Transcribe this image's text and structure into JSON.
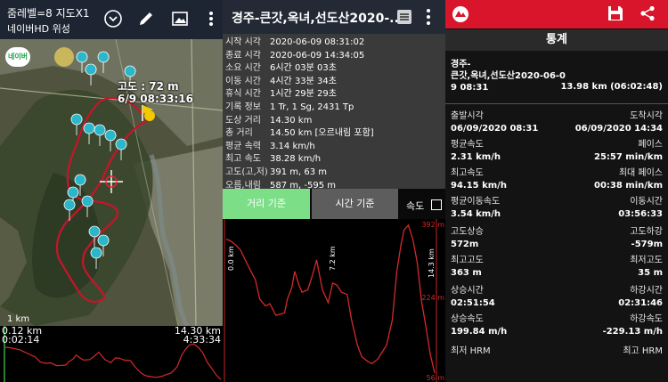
{
  "map_panel": {
    "status_line1": "줌레벨=8 지도X1",
    "status_line2": "네이버HD 위성",
    "naver_badge": "네이버",
    "altitude_line1": "고도 : 72 m",
    "altitude_line2": "6/9 08:33:16",
    "scale": "1 km",
    "chart_left_top": "0.12 km",
    "chart_left_bottom": "0:02:14",
    "chart_right_top": "14.30 km",
    "chart_right_bottom": "4:33:34",
    "icons": [
      "chevron-down-icon",
      "pencil-icon",
      "image-icon",
      "more-vert-icon"
    ]
  },
  "track_panel": {
    "title": "경주-큰갓,옥녀,선도산2020-...",
    "stats": [
      {
        "key": "시작 시각",
        "value": "2020-06-09 08:31:02"
      },
      {
        "key": "종료 시각",
        "value": "2020-06-09 14:34:05"
      },
      {
        "key": "소요 시간",
        "value": "6시간 03분 03초"
      },
      {
        "key": "이동 시간",
        "value": "4시간 33분 34초"
      },
      {
        "key": "휴식 시간",
        "value": "1시간 29분 29초"
      },
      {
        "key": "기록 정보",
        "value": "1 Tr, 1 Sg, 2431 Tp"
      },
      {
        "key": "도상 거리",
        "value": "14.30 km"
      },
      {
        "key": "총 거리",
        "value": "14.50 km [오르내림 포함]"
      },
      {
        "key": "평균 속력",
        "value": "3.14 km/h"
      },
      {
        "key": "최고 속도",
        "value": "38.28 km/h"
      },
      {
        "key": "고도(고,저)",
        "value": "391 m, 63 m"
      },
      {
        "key": "오름,내림",
        "value": "587 m, -595 m"
      }
    ],
    "btn_distance": "거리 기준",
    "btn_time": "시간 기준",
    "speed_label": "속도",
    "chart_labels": {
      "x_start": "0.0 km",
      "x_mid": "7.2 km",
      "x_end": "14.3 km",
      "y_top": "392 m",
      "y_mid": "224 m",
      "y_bottom": "56 m"
    }
  },
  "stats_panel": {
    "title": "통계",
    "route_lines": [
      "경주-",
      "큰갓,옥녀,선도산2020-06-0",
      "9 08:31"
    ],
    "distance": "13.98 km (06:02:48)",
    "rows": [
      {
        "lk": "출발시각",
        "lv": "06/09/2020 08:31",
        "rk": "도착시각",
        "rv": "06/09/2020 14:34"
      },
      {
        "lk": "평균속도",
        "lv": "2.31 km/h",
        "rk": "페이스",
        "rv": "25:57 min/km"
      },
      {
        "lk": "최고속도",
        "lv": "94.15 km/h",
        "rk": "최대 페이스",
        "rv": "00:38 min/km"
      },
      {
        "lk": "평균이동속도",
        "lv": "3.54 km/h",
        "rk": "이동시간",
        "rv": "03:56:33"
      },
      {
        "lk": "고도상승",
        "lv": "572m",
        "rk": "고도하강",
        "rv": "-579m"
      },
      {
        "lk": "최고고도",
        "lv": "363 m",
        "rk": "최저고도",
        "rv": "35 m"
      },
      {
        "lk": "상승시간",
        "lv": "02:51:54",
        "rk": "하강시간",
        "rv": "02:31:46"
      },
      {
        "lk": "상승속도",
        "lv": "199.84 m/h",
        "rk": "하강속도",
        "rv": "-229.13 m/h"
      },
      {
        "lk": "최저 HRM",
        "lv": "",
        "rk": "최고 HRM",
        "rv": ""
      }
    ]
  },
  "colors": {
    "track_header": "#232a36",
    "stats_header": "#d8152a",
    "btn_active": "#7cde86",
    "elevation_line": "#d42a2a",
    "map_track": "#c8142b"
  },
  "chart_data": {
    "type": "line",
    "title": "",
    "xlabel": "",
    "ylabel": "",
    "x_unit": "km",
    "y_unit": "m",
    "xlim": [
      0,
      14.3
    ],
    "ylim": [
      56,
      392
    ],
    "x_ticks": [
      "0.0 km",
      "7.2 km",
      "14.3 km"
    ],
    "y_ticks": [
      "392 m",
      "224 m",
      "56 m"
    ],
    "series": [
      {
        "x": [
          0.0,
          0.3,
          0.7,
          1.0,
          1.3,
          1.6,
          2.0,
          2.3,
          2.7,
          3.0,
          3.4,
          3.7,
          4.0,
          4.2,
          4.5,
          4.7,
          5.0,
          5.2,
          5.6,
          5.9,
          6.2,
          6.6,
          7.0,
          7.3,
          7.6,
          7.9,
          8.3,
          8.6,
          9.0,
          9.3,
          9.7,
          10.0,
          10.4,
          10.7,
          11.0,
          11.4,
          11.7,
          12.0,
          12.2,
          12.5,
          12.8,
          13.1,
          13.4,
          13.7,
          14.0,
          14.3
        ],
        "values": [
          360,
          356,
          346,
          335,
          315,
          296,
          272,
          230,
          215,
          220,
          195,
          197,
          200,
          230,
          255,
          290,
          260,
          245,
          250,
          280,
          315,
          250,
          222,
          265,
          260,
          245,
          240,
          185,
          130,
          105,
          95,
          90,
          100,
          115,
          130,
          185,
          290,
          350,
          380,
          390,
          360,
          310,
          225,
          170,
          110,
          70
        ]
      }
    ]
  }
}
